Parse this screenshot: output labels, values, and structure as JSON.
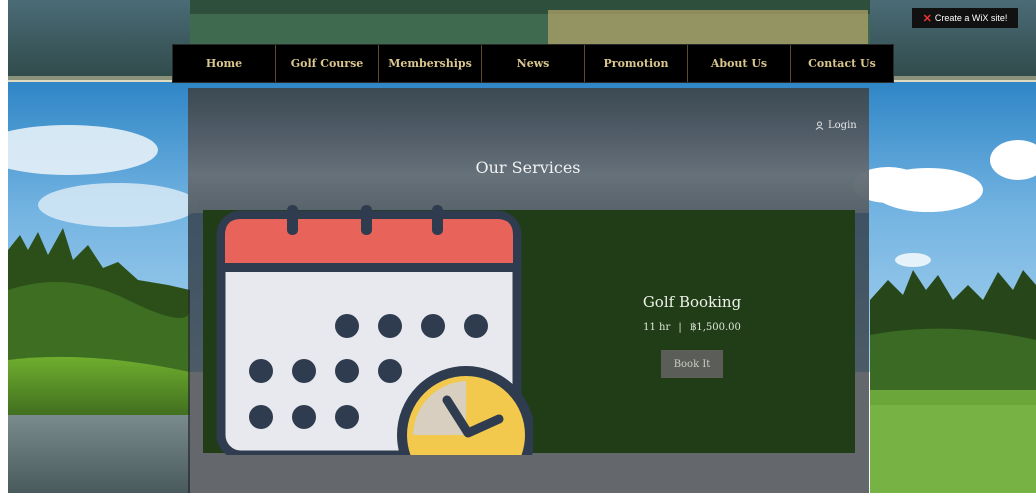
{
  "nav": {
    "items": [
      "Home",
      "Golf Course",
      "Memberships",
      "News",
      "Promotion",
      "About Us",
      "Contact Us"
    ]
  },
  "wix_banner": "Create a WiX site!",
  "panel": {
    "login": "Login",
    "title": "Our Services"
  },
  "service": {
    "name": "Golf Booking",
    "duration": "11 hr",
    "price": "฿1,500.00",
    "book_label": "Book It"
  },
  "colors": {
    "nav_bg": "#000000",
    "nav_text": "#d9c68e",
    "card_bg": "#213d17",
    "calendar_red": "#e8645a",
    "calendar_dark": "#2f3b4e",
    "clock_yellow": "#f2c94c"
  }
}
